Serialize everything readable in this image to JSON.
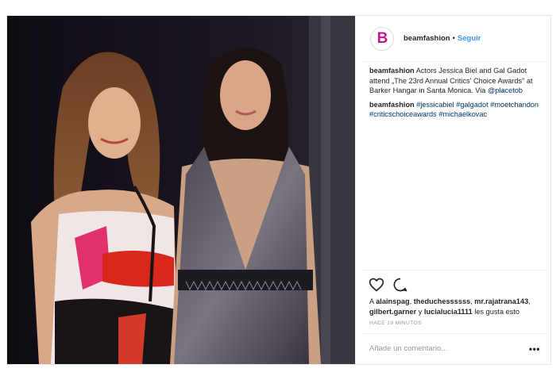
{
  "post": {
    "account": "beamfashion",
    "avatar_letter": "B",
    "separator": "•",
    "follow_label": "Seguir",
    "caption_user": "beamfashion",
    "caption_text": "Actors Jessica Biel and Gal Gadot attend „The 23rd Annual Critics' Choice Awards\" at Barker Hangar in Santa Monica. Via",
    "caption_mention": "@placetob",
    "comment_user": "beamfashion",
    "hashtags": [
      "#jessicabiel",
      "#galgadot",
      "#moetchandon",
      "#criticschoiceawards",
      "#michaelkovac"
    ],
    "likes_prefix": "A",
    "likers": [
      "alainspag",
      "theduchessssss",
      "mr.rajatrana143",
      "gilbert.garner",
      "lucialucia1111"
    ],
    "likes_joiner": "y",
    "likes_suffix": "les gusta esto",
    "timestamp": "HACE 19 MINUTOS",
    "comment_placeholder": "Añade un comentario...",
    "more_label": "•••",
    "like_icon": "heart-outline-icon",
    "comment_icon": "speech-bubble-icon",
    "accent_color": "#c2188a",
    "link_color": "#003569",
    "follow_color": "#3897f0"
  }
}
